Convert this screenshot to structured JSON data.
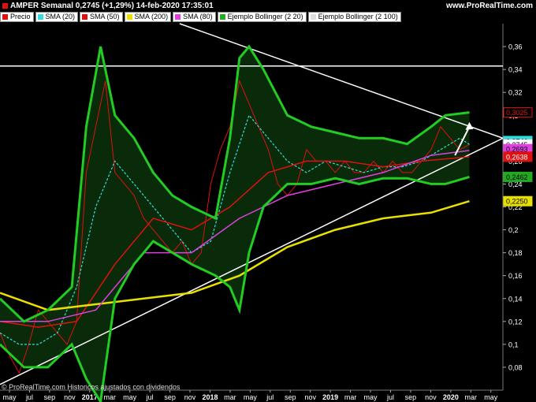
{
  "header": {
    "title": "AMPER Semanal 0,2745 (+1,29%) 14-feb-2020 17:35:01",
    "site": "www.ProRealTime.com"
  },
  "legend": [
    {
      "label": "Precio",
      "color": "#e01010"
    },
    {
      "label": "SMA (20)",
      "color": "#33dddd"
    },
    {
      "label": "SMA (50)",
      "color": "#e01010"
    },
    {
      "label": "SMA (200)",
      "color": "#e8e000"
    },
    {
      "label": "SMA (80)",
      "color": "#e040e0"
    },
    {
      "label": "Ejemplo Bollinger (2 20)",
      "color": "#22aa22"
    },
    {
      "label": "Ejemplo Bollinger (2 100)",
      "color": "#dddddd"
    }
  ],
  "footer": "© ProRealTime.com  Historicos ajustados con dividendos",
  "chart_data": {
    "type": "line",
    "ylim": [
      0.06,
      0.38
    ],
    "y_ticks": [
      "0,36",
      "0,34",
      "0,32",
      "0,3",
      "0,28",
      "0,26",
      "0,24",
      "0,22",
      "0,2",
      "0,18",
      "0,16",
      "0,14",
      "0,12",
      "0,1",
      "0,08"
    ],
    "y_tick_values": [
      0.36,
      0.34,
      0.32,
      0.3,
      0.28,
      0.26,
      0.24,
      0.22,
      0.2,
      0.18,
      0.16,
      0.14,
      0.12,
      0.1,
      0.08
    ],
    "x_ticks": [
      "may",
      "jul",
      "sep",
      "nov",
      "2017",
      "mar",
      "may",
      "jul",
      "sep",
      "nov",
      "2018",
      "mar",
      "may",
      "jul",
      "sep",
      "nov",
      "2019",
      "mar",
      "may",
      "jul",
      "sep",
      "nov",
      "2020",
      "mar",
      "may"
    ],
    "bold_x_ticks": [
      "2017",
      "2018",
      "2019",
      "2020"
    ],
    "price_labels": [
      {
        "text": "0,3025",
        "value": 0.3025,
        "bg": "#e01010",
        "fg": "#e01010"
      },
      {
        "text": "0,2746",
        "value": 0.2775,
        "bg": "#33dddd",
        "fg": "#000"
      },
      {
        "text": "0,2745",
        "value": 0.2745,
        "bg": "#ffffff",
        "fg": "#000"
      },
      {
        "text": "0,2693",
        "value": 0.2705,
        "bg": "#e040e0",
        "fg": "#000"
      },
      {
        "text": "0,2638",
        "value": 0.2638,
        "bg": "#e01010",
        "fg": "#fff"
      },
      {
        "text": "0,2462",
        "value": 0.2462,
        "bg": "#22aa22",
        "fg": "#000"
      },
      {
        "text": "0,2250",
        "value": 0.225,
        "bg": "#e8e000",
        "fg": "#000"
      }
    ],
    "series": [
      {
        "name": "Precio",
        "color": "#e01010",
        "x": [
          0,
          4,
          8,
          12,
          16,
          20,
          24,
          28,
          32,
          36,
          40,
          44,
          48,
          52,
          56,
          60,
          64,
          68,
          72,
          76,
          80,
          84,
          88,
          92,
          96,
          100,
          104,
          108,
          112,
          116,
          120,
          124,
          128,
          132,
          136,
          140,
          144,
          148,
          152,
          156,
          160,
          164,
          168,
          172,
          176,
          180,
          184,
          188,
          192,
          196
        ],
        "y": [
          0.11,
          0.09,
          0.075,
          0.1,
          0.13,
          0.12,
          0.11,
          0.1,
          0.12,
          0.25,
          0.29,
          0.33,
          0.25,
          0.24,
          0.23,
          0.21,
          0.2,
          0.19,
          0.18,
          0.19,
          0.17,
          0.18,
          0.24,
          0.27,
          0.29,
          0.33,
          0.31,
          0.29,
          0.27,
          0.24,
          0.23,
          0.24,
          0.27,
          0.26,
          0.26,
          0.25,
          0.26,
          0.25,
          0.25,
          0.26,
          0.25,
          0.26,
          0.25,
          0.25,
          0.26,
          0.27,
          0.29,
          0.28,
          0.27,
          0.2745
        ]
      },
      {
        "name": "SMA (20)",
        "color": "#33dddd",
        "x": [
          0,
          8,
          16,
          24,
          32,
          40,
          48,
          56,
          64,
          72,
          80,
          88,
          96,
          104,
          112,
          120,
          128,
          136,
          144,
          152,
          160,
          168,
          176,
          184,
          192,
          196
        ],
        "y": [
          0.11,
          0.1,
          0.1,
          0.11,
          0.15,
          0.22,
          0.26,
          0.24,
          0.22,
          0.2,
          0.18,
          0.19,
          0.25,
          0.3,
          0.28,
          0.26,
          0.25,
          0.26,
          0.255,
          0.25,
          0.255,
          0.255,
          0.26,
          0.27,
          0.28,
          0.2746
        ]
      },
      {
        "name": "SMA (50)",
        "color": "#e01010",
        "x": [
          0,
          16,
          32,
          48,
          64,
          80,
          96,
          112,
          128,
          144,
          160,
          176,
          196
        ],
        "y": [
          0.12,
          0.115,
          0.12,
          0.17,
          0.21,
          0.2,
          0.22,
          0.25,
          0.26,
          0.26,
          0.255,
          0.26,
          0.2638
        ]
      },
      {
        "name": "SMA (200)",
        "color": "#e8e000",
        "x": [
          0,
          20,
          40,
          60,
          80,
          100,
          120,
          140,
          160,
          180,
          196
        ],
        "y": [
          0.145,
          0.13,
          0.135,
          0.14,
          0.145,
          0.16,
          0.185,
          0.2,
          0.21,
          0.215,
          0.225
        ]
      },
      {
        "name": "SMA (80)",
        "color": "#e040e0",
        "x": [
          0,
          20,
          40,
          60,
          80,
          100,
          120,
          140,
          160,
          180,
          196
        ],
        "y": [
          0.12,
          0.12,
          0.13,
          0.18,
          0.18,
          0.21,
          0.23,
          0.24,
          0.25,
          0.265,
          0.2693
        ]
      }
    ],
    "bollinger_20": {
      "upper": {
        "x": [
          0,
          10,
          20,
          30,
          36,
          42,
          48,
          56,
          64,
          72,
          80,
          90,
          96,
          100,
          104,
          110,
          120,
          130,
          140,
          150,
          160,
          170,
          180,
          186,
          196
        ],
        "y": [
          0.14,
          0.12,
          0.13,
          0.15,
          0.29,
          0.36,
          0.3,
          0.28,
          0.25,
          0.23,
          0.22,
          0.21,
          0.28,
          0.35,
          0.36,
          0.34,
          0.3,
          0.29,
          0.285,
          0.28,
          0.28,
          0.275,
          0.29,
          0.3,
          0.3025
        ]
      },
      "lower": {
        "x": [
          0,
          10,
          20,
          30,
          36,
          42,
          48,
          56,
          64,
          72,
          80,
          90,
          96,
          100,
          104,
          110,
          120,
          130,
          140,
          150,
          160,
          170,
          180,
          186,
          196
        ],
        "y": [
          0.1,
          0.08,
          0.08,
          0.1,
          0.07,
          0.05,
          0.14,
          0.17,
          0.19,
          0.18,
          0.17,
          0.16,
          0.15,
          0.13,
          0.18,
          0.22,
          0.24,
          0.24,
          0.245,
          0.24,
          0.245,
          0.245,
          0.24,
          0.24,
          0.2462
        ]
      }
    },
    "trendlines": [
      {
        "from": [
          0,
          0.065
        ],
        "to": [
          210,
          0.28
        ]
      },
      {
        "from": [
          75,
          0.38
        ],
        "to": [
          210,
          0.28
        ]
      },
      {
        "from": [
          0,
          0.343
        ],
        "to": [
          210,
          0.343
        ]
      }
    ],
    "arrow": {
      "from": [
        190,
        0.265
      ],
      "to": [
        196,
        0.29
      ]
    }
  }
}
